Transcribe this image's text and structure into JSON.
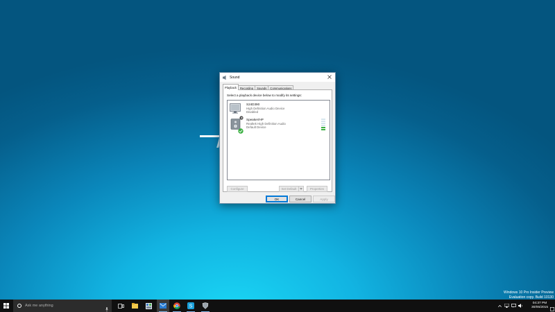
{
  "desktop": {},
  "dialog": {
    "title": "Sound",
    "tabs": [
      {
        "label": "Playback",
        "active": true
      },
      {
        "label": "Recording"
      },
      {
        "label": "Sounds"
      },
      {
        "label": "Communications"
      }
    ],
    "instruction": "Select a playback device below to modify its settings:",
    "devices": [
      {
        "name": "S24D390",
        "line1": "High Definition Audio Device",
        "line2": "Disabled",
        "icon": "monitor-speaker-icon",
        "status_icon": "disabled-arrow-icon"
      },
      {
        "name": "Speaker/HP",
        "line1": "Realtek High Definition Audio",
        "line2": "Default Device",
        "icon": "speaker-icon",
        "status_icon": "default-check-icon",
        "level": 0.25
      }
    ],
    "buttons": {
      "configure": "Configure",
      "set_default": "Set Default",
      "properties": "Properties",
      "ok": "OK",
      "cancel": "Cancel",
      "apply": "Apply"
    }
  },
  "watermark": {
    "line1": "Windows 10 Pro Insider Preview",
    "line2": "Evaluation copy. Build 10130"
  },
  "taskbar": {
    "search_placeholder": "Ask me anything",
    "clock_time": "04:37 PM",
    "clock_date": "30/05/2015",
    "apps": [
      "task-view-icon",
      "file-explorer-icon",
      "control-panel-icon",
      "mail-icon",
      "chrome-icon",
      "skype-icon",
      "settings-icon"
    ]
  },
  "colors": {
    "accent": "#0078d7",
    "taskbar": "#101010",
    "check_green": "#3cb043"
  }
}
